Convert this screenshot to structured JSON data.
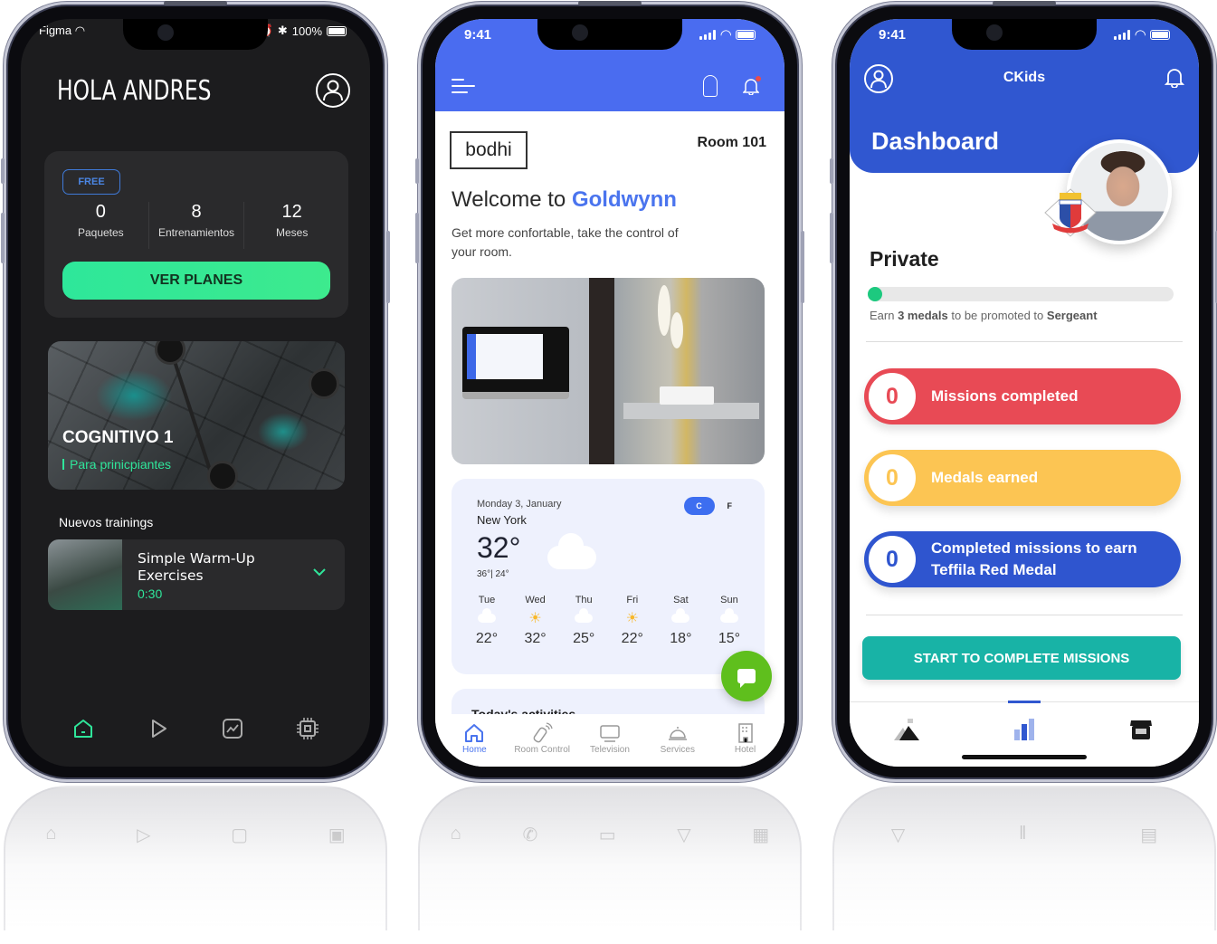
{
  "phones": {
    "fitness": {
      "status": {
        "carrier": "Figma",
        "battery": "100%"
      },
      "greeting": "HOLA ANDRES",
      "plan_badge": "FREE",
      "stats": [
        {
          "value": "0",
          "label": "Paquetes"
        },
        {
          "value": "8",
          "label": "Entrenamientos"
        },
        {
          "value": "12",
          "label": "Meses"
        }
      ],
      "cta_label": "VER PLANES",
      "hero": {
        "title": "COGNITIVO 1",
        "subtitle": "Para prinicpiantes"
      },
      "section_title": "Nuevos trainings",
      "training": {
        "title": "Simple Warm-Up Exercises",
        "duration": "0:30"
      },
      "nav": [
        {
          "icon": "home-icon",
          "active": true
        },
        {
          "icon": "play-icon",
          "active": false
        },
        {
          "icon": "chart-icon",
          "active": false
        },
        {
          "icon": "chip-icon",
          "active": false
        }
      ],
      "accent": "#2fe59a"
    },
    "hotel": {
      "status": {
        "time": "9:41"
      },
      "brand_logo": "bodhi",
      "room": "Room 101",
      "welcome_prefix": "Welcome to",
      "hotel_name": "Goldwynn",
      "welcome_sub": "Get more confortable, take the control of your room.",
      "weather": {
        "date": "Monday 3, January",
        "city": "New York",
        "temp": "32°",
        "hilo": "36°| 24°",
        "units": {
          "selected": "C",
          "other": "F"
        },
        "forecast": [
          {
            "day": "Tue",
            "icon": "cloud",
            "temp": "22°"
          },
          {
            "day": "Wed",
            "icon": "sun",
            "temp": "32°"
          },
          {
            "day": "Thu",
            "icon": "cloud",
            "temp": "25°"
          },
          {
            "day": "Fri",
            "icon": "sun",
            "temp": "22°"
          },
          {
            "day": "Sat",
            "icon": "cloud",
            "temp": "18°"
          },
          {
            "day": "Sun",
            "icon": "cloud",
            "temp": "15°"
          }
        ]
      },
      "activities_title": "Today's activities",
      "nav": [
        {
          "label": "Home",
          "icon": "home-icon",
          "active": true
        },
        {
          "label": "Room Control",
          "icon": "remote-icon",
          "active": false
        },
        {
          "label": "Television",
          "icon": "tv-icon",
          "active": false
        },
        {
          "label": "Services",
          "icon": "service-bell-icon",
          "active": false
        },
        {
          "label": "Hotel",
          "icon": "hotel-icon",
          "active": false
        }
      ],
      "accent": "#4a6cf0"
    },
    "ckids": {
      "status": {
        "time": "9:41"
      },
      "app_title": "CKids",
      "page_title": "Dashboard",
      "rank": "Private",
      "rank_progress": 0.02,
      "promote": {
        "pre": "Earn",
        "medals": "3 medals",
        "mid": "to be promoted to",
        "next_rank": "Sergeant"
      },
      "stats": [
        {
          "value": "0",
          "label": "Missions completed",
          "color": "#e84a55"
        },
        {
          "value": "0",
          "label": "Medals earned",
          "color": "#fcc553"
        },
        {
          "value": "0",
          "label": "Completed missions to earn Teffila Red Medal",
          "color": "#2f55cf"
        }
      ],
      "cta_label": "START TO COMPLETE MISSIONS",
      "nav": [
        {
          "icon": "mountain-flag-icon",
          "active": false
        },
        {
          "icon": "bar-chart-icon",
          "active": true
        },
        {
          "icon": "store-icon",
          "active": false
        }
      ],
      "accent": "#3057d0"
    }
  }
}
